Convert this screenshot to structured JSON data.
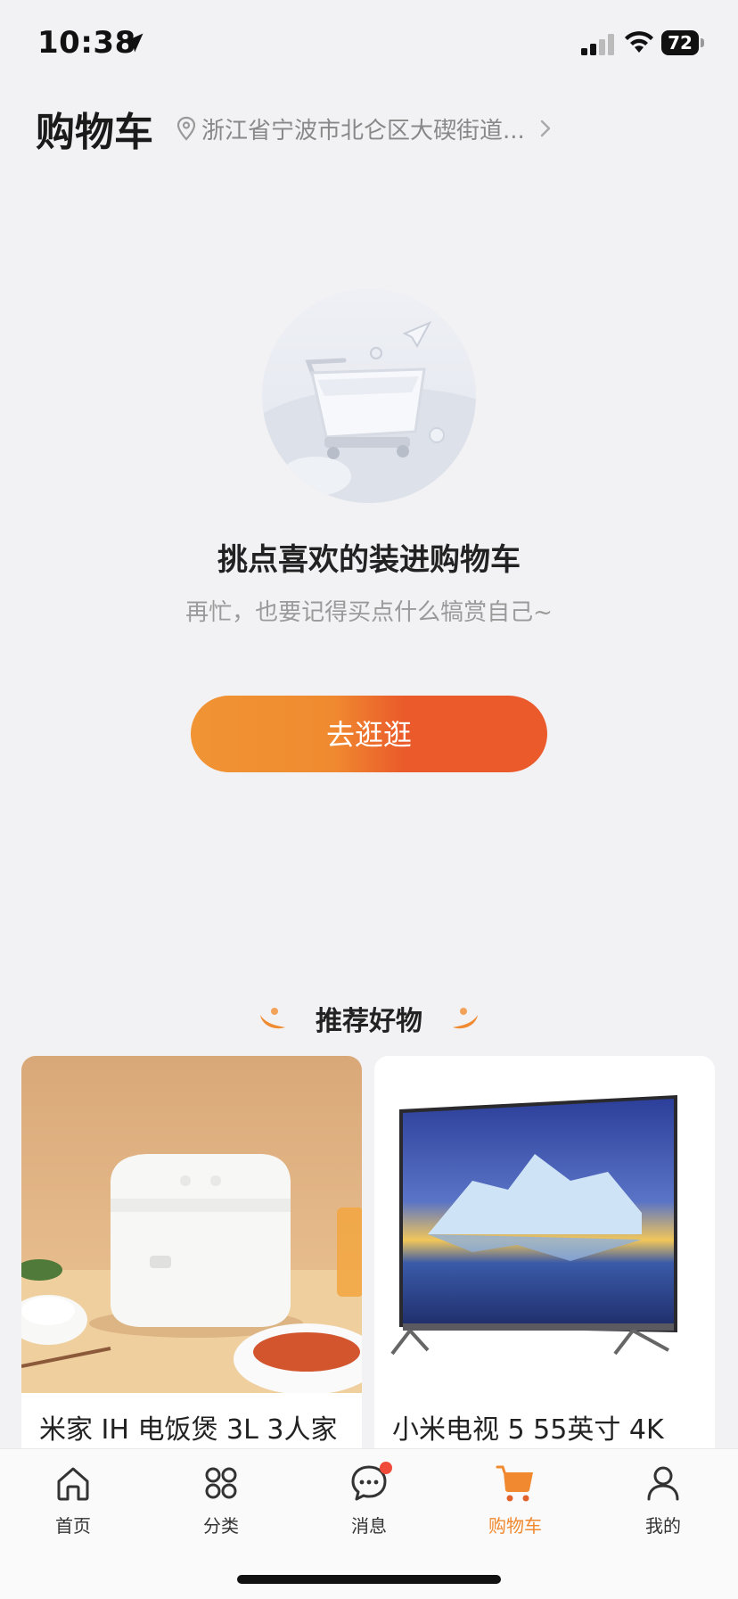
{
  "status_bar": {
    "time": "10:38",
    "battery": "72"
  },
  "header": {
    "title": "购物车",
    "address": "浙江省宁波市北仑区大碶街道..."
  },
  "empty_state": {
    "title": "挑点喜欢的装进购物车",
    "subtitle": "再忙，也要记得买点什么犒赏自己~",
    "button_label": "去逛逛"
  },
  "recommend": {
    "title": "推荐好物",
    "products": [
      {
        "title": "米家 IH 电饭煲 3L 3人家"
      },
      {
        "title": "小米电视 5 55英寸 4K"
      }
    ]
  },
  "tab_bar": {
    "items": [
      {
        "label": "首页",
        "icon": "home-icon"
      },
      {
        "label": "分类",
        "icon": "category-icon"
      },
      {
        "label": "消息",
        "icon": "message-icon"
      },
      {
        "label": "购物车",
        "icon": "cart-icon"
      },
      {
        "label": "我的",
        "icon": "profile-icon"
      }
    ],
    "active": "购物车"
  },
  "colors": {
    "accent": "#f0892f",
    "button_start": "#f09434",
    "button_end": "#ea5a2a",
    "badge": "#f04a3a"
  }
}
